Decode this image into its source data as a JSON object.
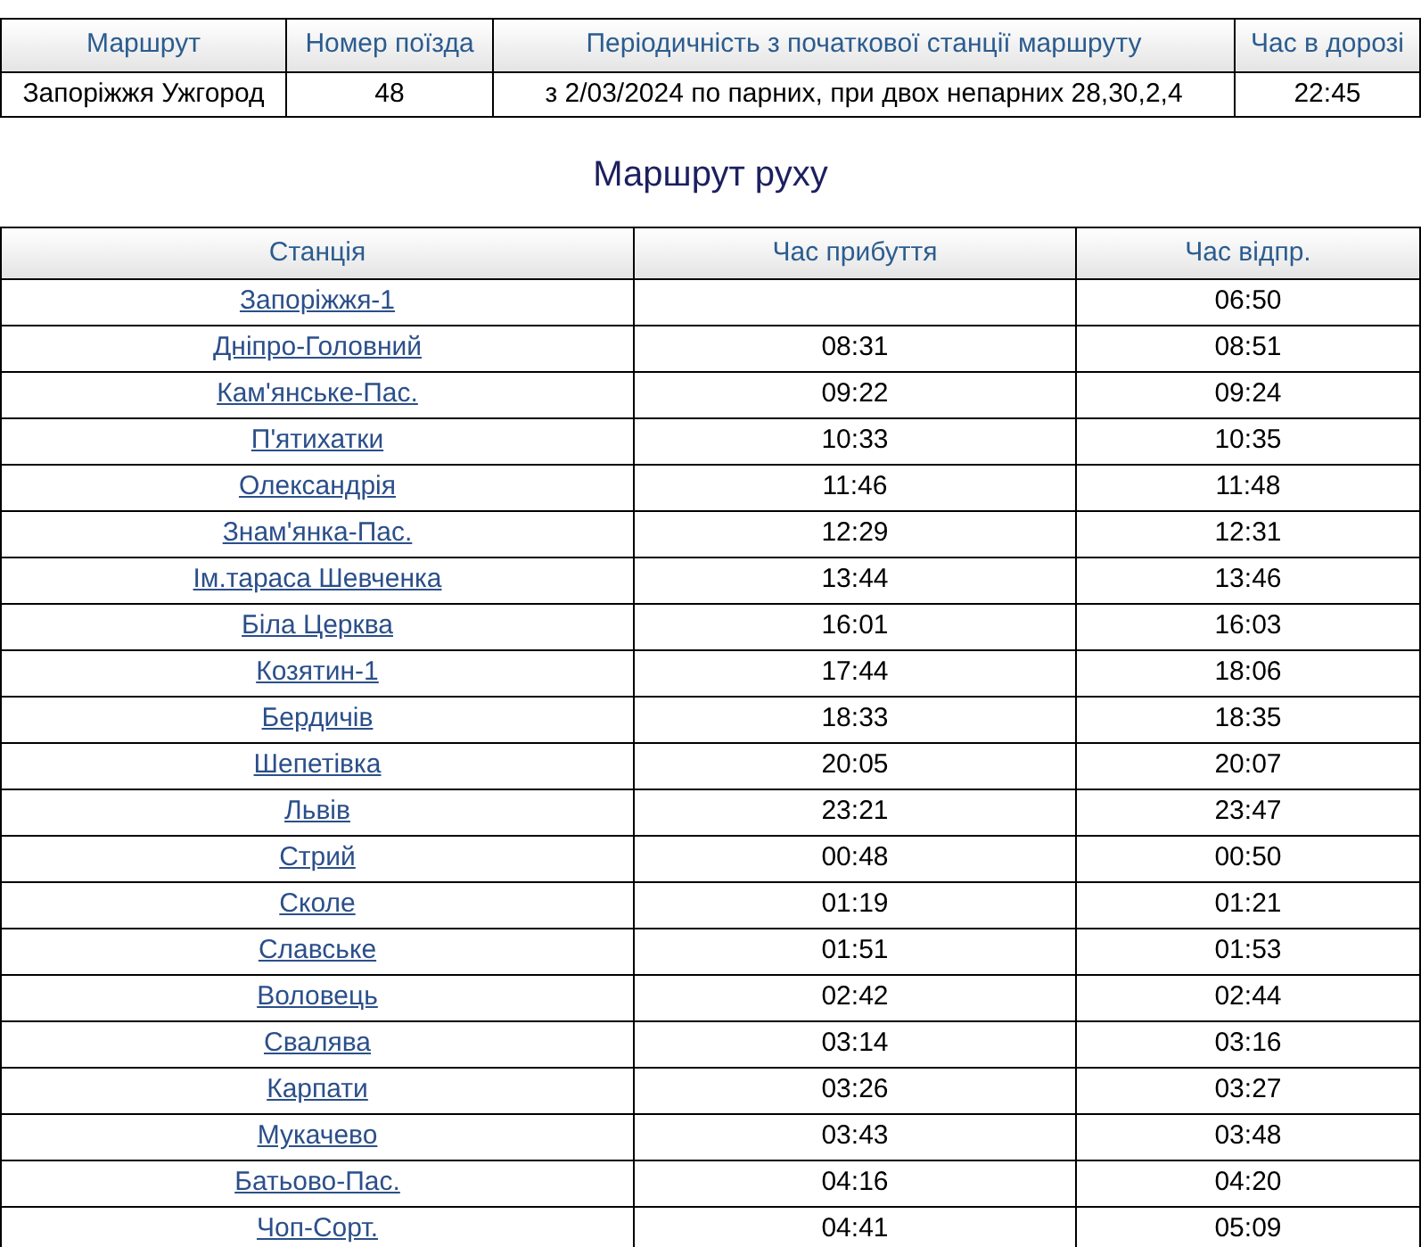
{
  "summary": {
    "columns": [
      "Маршрут",
      "Номер поїзда",
      "Періодичність з початкової станції маршруту",
      "Час в дорозі"
    ],
    "row": [
      "Запоріжжя Ужгород",
      "48",
      "з 2/03/2024 по парних, при двох непарних 28,30,2,4",
      "22:45"
    ]
  },
  "title": "Маршрут руху",
  "schedule": {
    "columns": [
      "Станція",
      "Час прибуття",
      "Час відпр."
    ],
    "rows": [
      {
        "station": "Запоріжжя-1",
        "arrival": "",
        "departure": "06:50"
      },
      {
        "station": "Дніпро-Головний",
        "arrival": "08:31",
        "departure": "08:51"
      },
      {
        "station": "Кам'янське-Пас.",
        "arrival": "09:22",
        "departure": "09:24"
      },
      {
        "station": "П'ятихатки",
        "arrival": "10:33",
        "departure": "10:35"
      },
      {
        "station": "Олександрія",
        "arrival": "11:46",
        "departure": "11:48"
      },
      {
        "station": "Знам'янка-Пас.",
        "arrival": "12:29",
        "departure": "12:31"
      },
      {
        "station": "Ім.тараса Шевченка",
        "arrival": "13:44",
        "departure": "13:46"
      },
      {
        "station": "Біла Церква",
        "arrival": "16:01",
        "departure": "16:03"
      },
      {
        "station": "Козятин-1",
        "arrival": "17:44",
        "departure": "18:06"
      },
      {
        "station": "Бердичів",
        "arrival": "18:33",
        "departure": "18:35"
      },
      {
        "station": "Шепетівка",
        "arrival": "20:05",
        "departure": "20:07"
      },
      {
        "station": "Львів",
        "arrival": "23:21",
        "departure": "23:47"
      },
      {
        "station": "Стрий",
        "arrival": "00:48",
        "departure": "00:50"
      },
      {
        "station": "Сколе",
        "arrival": "01:19",
        "departure": "01:21"
      },
      {
        "station": "Славське",
        "arrival": "01:51",
        "departure": "01:53"
      },
      {
        "station": "Воловець",
        "arrival": "02:42",
        "departure": "02:44"
      },
      {
        "station": "Свалява",
        "arrival": "03:14",
        "departure": "03:16"
      },
      {
        "station": "Карпати",
        "arrival": "03:26",
        "departure": "03:27"
      },
      {
        "station": "Мукачево",
        "arrival": "03:43",
        "departure": "03:48"
      },
      {
        "station": "Батьово-Пас.",
        "arrival": "04:16",
        "departure": "04:20"
      },
      {
        "station": "Чоп-Сорт.",
        "arrival": "04:41",
        "departure": "05:09"
      }
    ]
  }
}
